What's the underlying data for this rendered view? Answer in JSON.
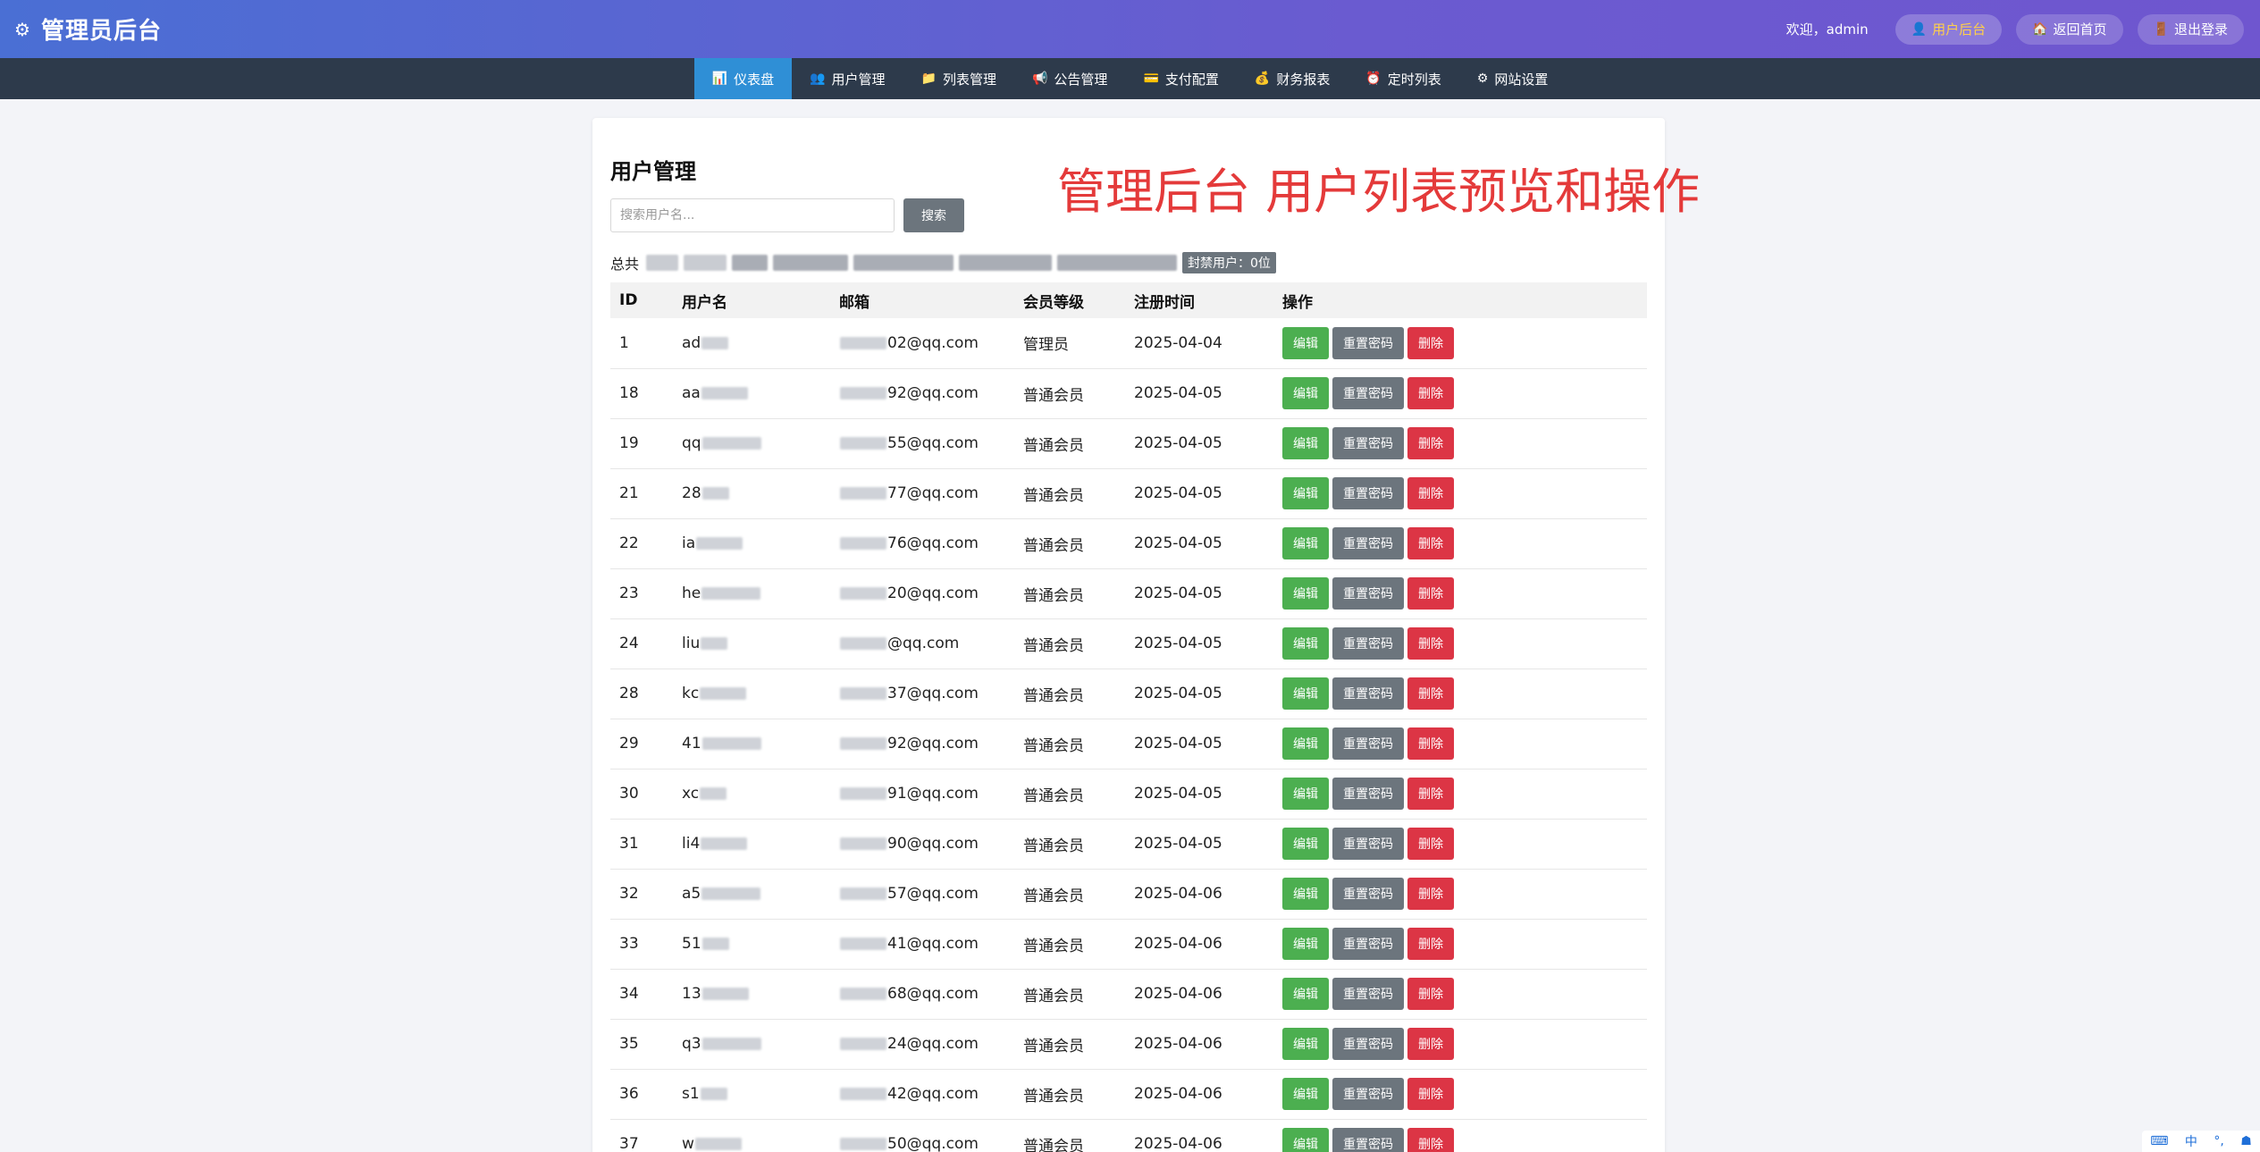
{
  "header": {
    "title": "管理员后台",
    "welcome": "欢迎，admin",
    "buttons": [
      {
        "label": "用户后台",
        "icon": "user-icon"
      },
      {
        "label": "返回首页",
        "icon": "home-icon"
      },
      {
        "label": "退出登录",
        "icon": "logout-icon"
      }
    ]
  },
  "nav": {
    "items": [
      {
        "label": "仪表盘",
        "icon": "📊"
      },
      {
        "label": "用户管理",
        "icon": "👥"
      },
      {
        "label": "列表管理",
        "icon": "📁"
      },
      {
        "label": "公告管理",
        "icon": "📢"
      },
      {
        "label": "支付配置",
        "icon": "💳"
      },
      {
        "label": "财务报表",
        "icon": "💰"
      },
      {
        "label": "定时列表",
        "icon": "⏰"
      },
      {
        "label": "网站设置",
        "icon": "⚙"
      }
    ]
  },
  "panel": {
    "title": "用户管理",
    "annotation": "管理后台  用户列表预览和操作",
    "search_placeholder": "搜索用户名...",
    "search_button": "搜索",
    "summary_prefix": "总共",
    "banned_label": "封禁用户：0位"
  },
  "table": {
    "headers": [
      "ID",
      "用户名",
      "邮箱",
      "会员等级",
      "注册时间",
      "操作"
    ],
    "actions": {
      "edit": "编辑",
      "reset": "重置密码",
      "delete": "删除"
    },
    "rows": [
      {
        "id": "1",
        "name": "ad",
        "email": "02@qq.com",
        "level": "管理员",
        "date": "2025-04-04"
      },
      {
        "id": "18",
        "name": "aa",
        "email": "92@qq.com",
        "level": "普通会员",
        "date": "2025-04-05"
      },
      {
        "id": "19",
        "name": "qq",
        "email": "55@qq.com",
        "level": "普通会员",
        "date": "2025-04-05"
      },
      {
        "id": "21",
        "name": "28",
        "email": "77@qq.com",
        "level": "普通会员",
        "date": "2025-04-05"
      },
      {
        "id": "22",
        "name": "ia",
        "email": "76@qq.com",
        "level": "普通会员",
        "date": "2025-04-05"
      },
      {
        "id": "23",
        "name": "he",
        "email": "20@qq.com",
        "level": "普通会员",
        "date": "2025-04-05"
      },
      {
        "id": "24",
        "name": "liu",
        "email": "@qq.com",
        "level": "普通会员",
        "date": "2025-04-05"
      },
      {
        "id": "28",
        "name": "kc",
        "email": "37@qq.com",
        "level": "普通会员",
        "date": "2025-04-05"
      },
      {
        "id": "29",
        "name": "41",
        "email": "92@qq.com",
        "level": "普通会员",
        "date": "2025-04-05"
      },
      {
        "id": "30",
        "name": "xc",
        "email": "91@qq.com",
        "level": "普通会员",
        "date": "2025-04-05"
      },
      {
        "id": "31",
        "name": "li4",
        "email": "90@qq.com",
        "level": "普通会员",
        "date": "2025-04-05"
      },
      {
        "id": "32",
        "name": "a5",
        "email": "57@qq.com",
        "level": "普通会员",
        "date": "2025-04-06"
      },
      {
        "id": "33",
        "name": "51",
        "email": "41@qq.com",
        "level": "普通会员",
        "date": "2025-04-06"
      },
      {
        "id": "34",
        "name": "13",
        "email": "68@qq.com",
        "level": "普通会员",
        "date": "2025-04-06"
      },
      {
        "id": "35",
        "name": "q3",
        "email": "24@qq.com",
        "level": "普通会员",
        "date": "2025-04-06"
      },
      {
        "id": "36",
        "name": "s1",
        "email": "42@qq.com",
        "level": "普通会员",
        "date": "2025-04-06"
      },
      {
        "id": "37",
        "name": "w",
        "email": "50@qq.com",
        "level": "普通会员",
        "date": "2025-04-06"
      }
    ]
  },
  "tray": {
    "ime": "中"
  }
}
